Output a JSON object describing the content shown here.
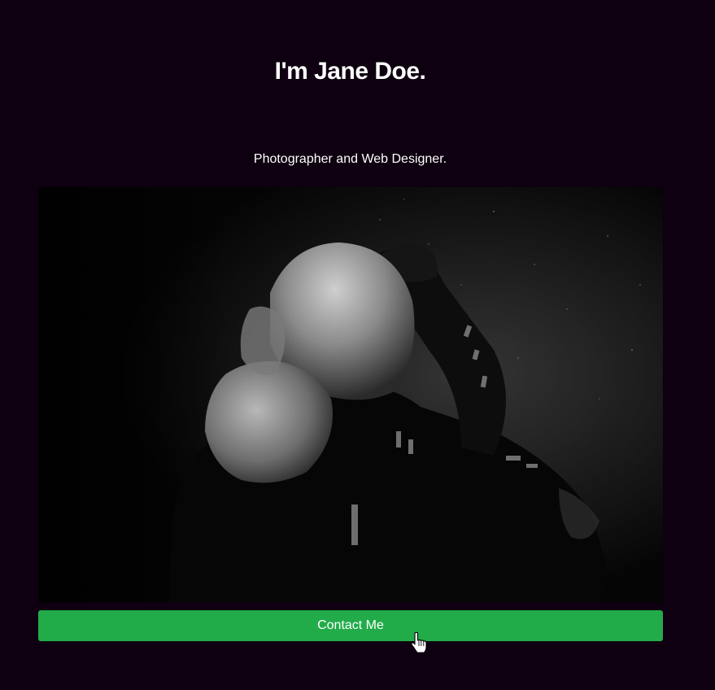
{
  "hero": {
    "heading": "I'm Jane Doe.",
    "subheading": "Photographer and Web Designer."
  },
  "image": {
    "name": "hooded-figure-photo"
  },
  "actions": {
    "contact_label": "Contact Me"
  },
  "colors": {
    "background": "#0e0010",
    "accent": "#22ac49",
    "text": "#ffffff"
  },
  "icons": {
    "cursor": "hand-pointer-icon"
  }
}
